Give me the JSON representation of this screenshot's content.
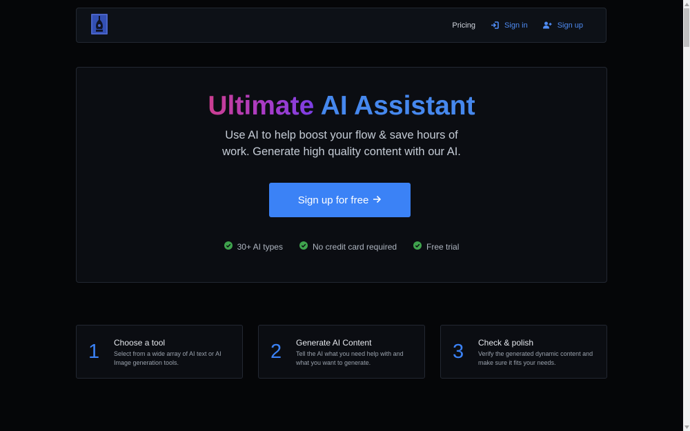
{
  "nav": {
    "pricing": "Pricing",
    "signin": "Sign in",
    "signup": "Sign up"
  },
  "hero": {
    "title_part1": "Ultimate",
    "title_part2": "AI Assistant",
    "subtitle": "Use AI to help boost your flow & save hours of work. Generate high quality content with our AI.",
    "cta": "Sign up for free",
    "features": [
      "30+ AI types",
      "No credit card required",
      "Free trial"
    ]
  },
  "steps": [
    {
      "number": "1",
      "title": "Choose a tool",
      "desc": "Select from a wide array of AI text or AI Image generation tools."
    },
    {
      "number": "2",
      "title": "Generate AI Content",
      "desc": "Tell the AI what you need help with and what you want to generate."
    },
    {
      "number": "3",
      "title": "Check & polish",
      "desc": "Verify the generated dynamic content and make sure it fits your needs."
    }
  ],
  "colors": {
    "accent": "#3b82f6",
    "title_gradient_start": "#cc3e8f",
    "title_gradient_end": "#7b3fe4",
    "check": "#3fa34d",
    "background": "#050608",
    "panel": "#0b0d12"
  },
  "icons": {
    "logo": "pen-nib-logo",
    "signin": "sign-in-icon",
    "signup": "user-plus-icon",
    "cta_arrow": "arrow-right-icon",
    "feature_check": "check-circle-icon"
  }
}
